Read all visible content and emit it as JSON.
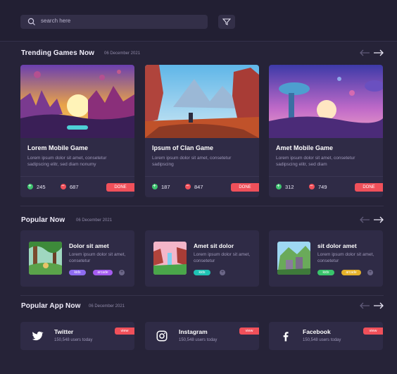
{
  "search": {
    "placeholder": "search here"
  },
  "sections": {
    "trending": {
      "title": "Trending Games Now",
      "date": "06 December 2021"
    },
    "popular": {
      "title": "Popular Now",
      "date": "06 December 2021"
    },
    "apps": {
      "title": "Popular App Now",
      "date": "06 December 2021"
    }
  },
  "trending_games": [
    {
      "title": "Lorem Mobile Game",
      "desc": "Lorem ipsum dolor sit amet, consetetur sadipscing elitr, sed diam nonumy",
      "up": "245",
      "down": "687",
      "status": "DONE"
    },
    {
      "title": "Ipsum of Clan Game",
      "desc": "Lorem ipsum dolor sit amet, consetetur sadipscing",
      "up": "187",
      "down": "847",
      "status": "DONE"
    },
    {
      "title": "Amet Mobile Game",
      "desc": "Lorem ipsum dolor sit amet, consetetur sadipscing elitr, sed diam",
      "up": "312",
      "down": "749",
      "status": "DONE"
    }
  ],
  "popular_now": [
    {
      "title": "Dolor sit amet",
      "desc": "Lorem ipsum dolor sit amet, consetetur",
      "tags": [
        "kids",
        "arcade"
      ]
    },
    {
      "title": "Amet sit dolor",
      "desc": "Lorem ipsum dolor sit amet, consetetur",
      "tags": [
        "kids"
      ]
    },
    {
      "title": "sit dolor amet",
      "desc": "Lorem ipsum dolor sit amet, consetetur",
      "tags": [
        "kids",
        "arcade"
      ]
    }
  ],
  "popular_apps": [
    {
      "name": "Twitter",
      "users": "150,548 users today",
      "action": "view",
      "icon": "twitter-icon"
    },
    {
      "name": "Instagram",
      "users": "150,548 users today",
      "action": "view",
      "icon": "instagram-icon"
    },
    {
      "name": "Facebook",
      "users": "150,548 users today",
      "action": "view",
      "icon": "facebook-icon"
    }
  ],
  "colors": {
    "background": "#262338",
    "card": "#2f2b46",
    "accent": "#f0505a",
    "up": "#3ec36f",
    "tag_kids_purple": "#8e6cf0",
    "tag_kids_teal": "#1fc2b4",
    "tag_kids_green": "#39c56b",
    "tag_arcade_purple": "#a55cf0",
    "tag_arcade_yellow": "#e5b12a"
  }
}
